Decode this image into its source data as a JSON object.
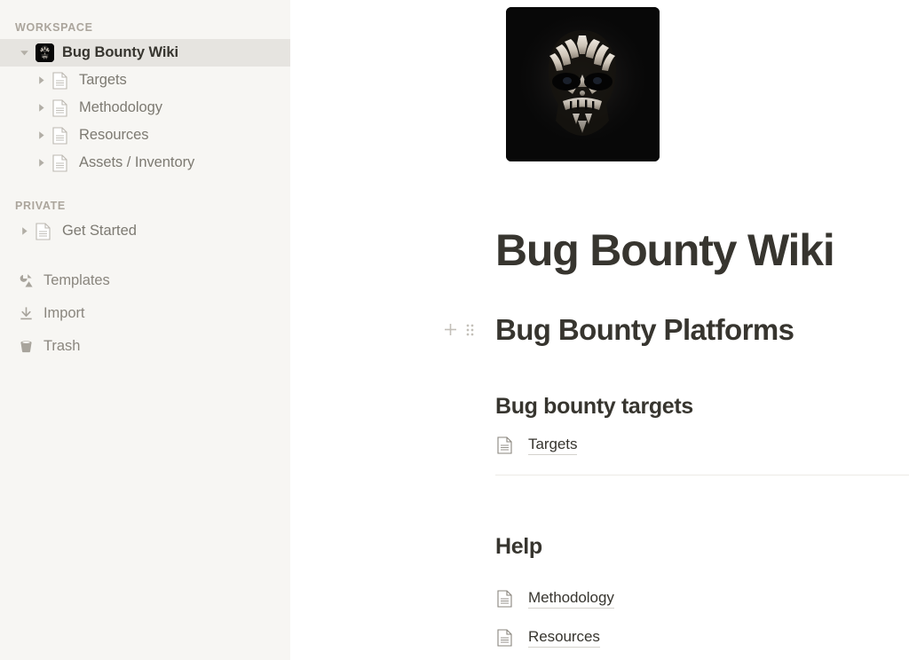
{
  "sidebar": {
    "workspace_label": "WORKSPACE",
    "private_label": "PRIVATE",
    "workspace_items": [
      {
        "label": "Bug Bounty Wiki",
        "icon": "skull-avatar-icon",
        "selected": true,
        "expanded": true,
        "level": 0
      },
      {
        "label": "Targets",
        "icon": "document-icon",
        "selected": false,
        "expanded": false,
        "level": 1
      },
      {
        "label": "Methodology",
        "icon": "document-icon",
        "selected": false,
        "expanded": false,
        "level": 1
      },
      {
        "label": "Resources",
        "icon": "document-icon",
        "selected": false,
        "expanded": false,
        "level": 1
      },
      {
        "label": "Assets / Inventory",
        "icon": "document-icon",
        "selected": false,
        "expanded": false,
        "level": 1
      }
    ],
    "private_items": [
      {
        "label": "Get Started",
        "icon": "document-icon",
        "selected": false,
        "expanded": false,
        "level": 0
      }
    ],
    "utility_items": [
      {
        "label": "Templates",
        "icon": "templates-icon"
      },
      {
        "label": "Import",
        "icon": "import-icon"
      },
      {
        "label": "Trash",
        "icon": "trash-icon"
      }
    ]
  },
  "page": {
    "cover_icon": "skull-face-paint-image",
    "title": "Bug Bounty Wiki",
    "heading_platforms": "Bug Bounty Platforms",
    "heading_targets": "Bug bounty targets",
    "heading_help": "Help",
    "link_targets": "Targets",
    "link_methodology": "Methodology",
    "link_resources": "Resources",
    "add_block_icon": "plus-icon",
    "drag_handle_icon": "drag-handle-icon"
  },
  "colors": {
    "sidebar_bg": "#f7f6f3",
    "selected_row": "#e6e4e0",
    "text_primary": "#37352f",
    "text_muted": "#7d7a72",
    "section_label": "#aba59c",
    "divider": "#eceae6",
    "main_bg": "#ffffff"
  }
}
